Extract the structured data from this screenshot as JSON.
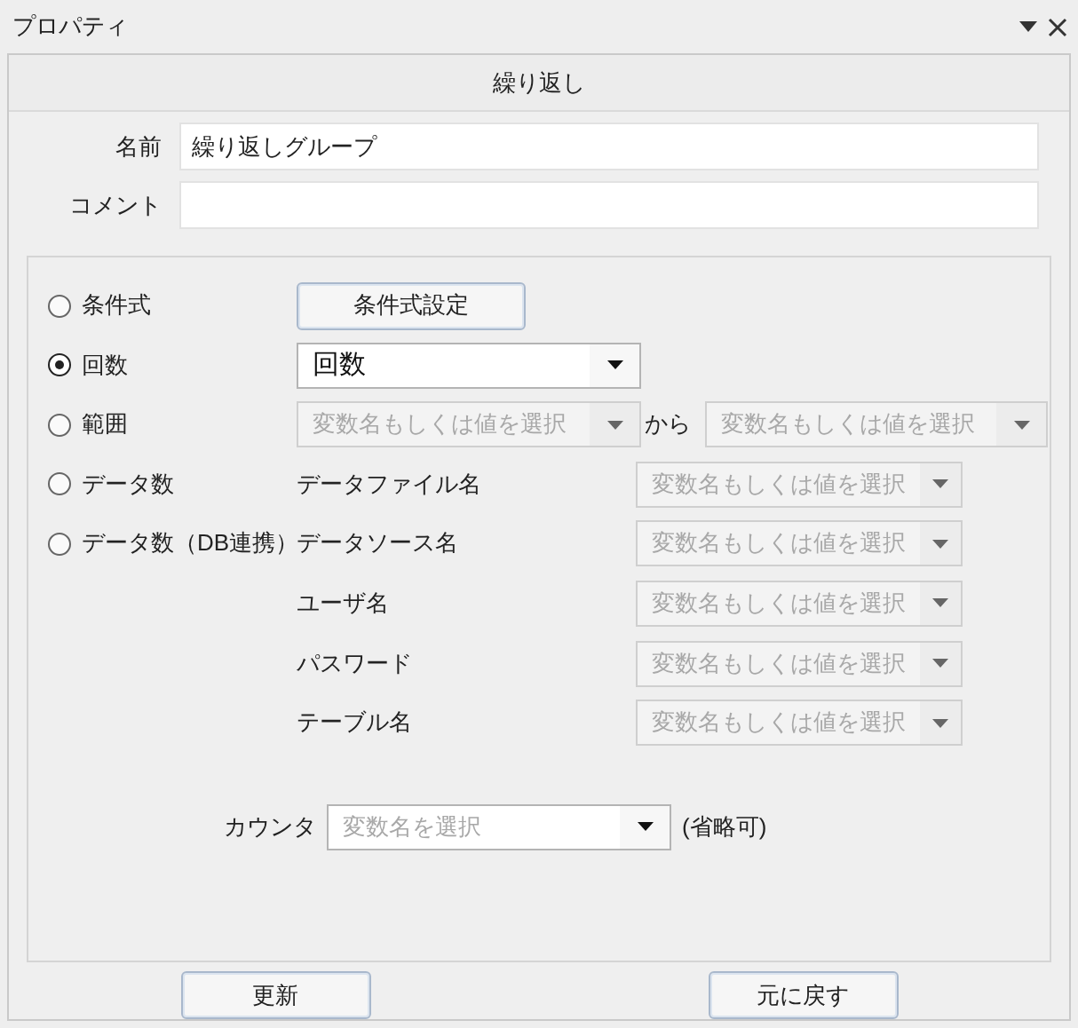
{
  "title": "プロパティ",
  "header": "繰り返し",
  "fields": [
    {
      "label": "名前",
      "value": "繰り返しグループ"
    },
    {
      "label": "コメント"
    }
  ],
  "modes": [
    {
      "label": "条件式",
      "selected": false
    },
    {
      "label": "回数",
      "selected": true
    },
    {
      "label": "範囲",
      "selected": false
    },
    {
      "label": "データ数",
      "selected": false
    },
    {
      "label": "データ数（DB連携）",
      "selected": false
    }
  ],
  "condition_button": "条件式設定",
  "count_combo": {
    "value": "回数",
    "disabled": false
  },
  "range": {
    "from": {
      "placeholder": "変数名もしくは値を選択",
      "disabled": true
    },
    "separator": "から",
    "to": {
      "placeholder": "変数名もしくは値を選択",
      "disabled": true
    }
  },
  "data_fields": [
    {
      "label": "データファイル名",
      "placeholder": "変数名もしくは値を選択",
      "disabled": true
    },
    {
      "label": "データソース名",
      "placeholder": "変数名もしくは値を選択",
      "disabled": true
    },
    {
      "label": "ユーザ名",
      "placeholder": "変数名もしくは値を選択",
      "disabled": true
    },
    {
      "label": "パスワード",
      "placeholder": "変数名もしくは値を選択",
      "disabled": true
    },
    {
      "label": "テーブル名",
      "placeholder": "変数名もしくは値を選択",
      "disabled": true
    }
  ],
  "counter": {
    "label": "カウンタ",
    "placeholder": "変数名を選択",
    "disabled": false,
    "note": "(省略可)"
  },
  "buttons": [
    "更新",
    "元に戻す"
  ]
}
